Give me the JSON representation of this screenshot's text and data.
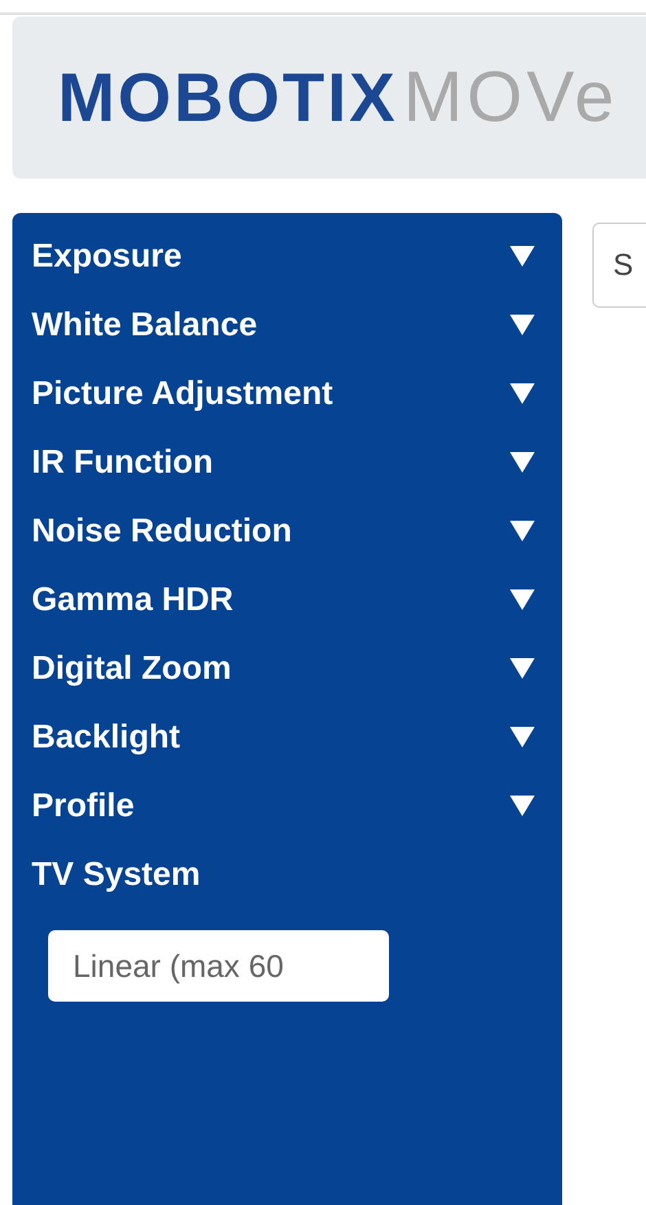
{
  "header": {
    "logo_primary": "MOBOTIX",
    "logo_secondary": "MOVe"
  },
  "sidebar": {
    "items": [
      {
        "kind": "section",
        "label": "Exposure"
      },
      {
        "kind": "section",
        "label": "White Balance"
      },
      {
        "kind": "section",
        "label": "Picture Adjustment"
      },
      {
        "kind": "section",
        "label": "IR Function"
      },
      {
        "kind": "section",
        "label": "Noise Reduction"
      },
      {
        "kind": "section",
        "label": "Gamma HDR"
      },
      {
        "kind": "section",
        "label": "Digital Zoom"
      },
      {
        "kind": "section",
        "label": "Backlight"
      },
      {
        "kind": "section",
        "label": "Profile"
      },
      {
        "kind": "label",
        "label": "TV System"
      }
    ],
    "tv_system_select": {
      "value": "Linear (max 60"
    }
  },
  "content": {
    "field": {
      "value": "S"
    }
  }
}
